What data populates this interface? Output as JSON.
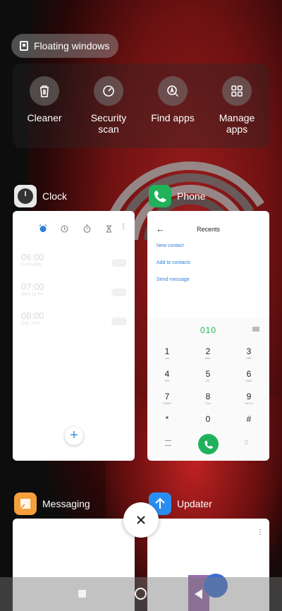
{
  "floating_windows": {
    "label": "Floating windows"
  },
  "tools": [
    {
      "label": "Cleaner",
      "icon": "trash-icon"
    },
    {
      "label": "Security scan",
      "icon": "shield-gauge-icon"
    },
    {
      "label": "Find apps",
      "icon": "search-a-icon"
    },
    {
      "label": "Manage apps",
      "icon": "grid-icon"
    }
  ],
  "apps": {
    "clock": {
      "name": "Clock",
      "alarms": [
        {
          "time": "06:00",
          "sub": "Everyday"
        },
        {
          "time": "07:00",
          "sub": "Mon to Fri"
        },
        {
          "time": "08:00",
          "sub": "Sat, Sun"
        }
      ],
      "fab": "+"
    },
    "phone": {
      "name": "Phone",
      "title": "Recents",
      "links": [
        "New contact",
        "Add to contacts",
        "Send message"
      ],
      "number": "010",
      "keys": [
        {
          "d": "1",
          "l": "ooo"
        },
        {
          "d": "2",
          "l": "ABC"
        },
        {
          "d": "3",
          "l": "DEF"
        },
        {
          "d": "4",
          "l": "GHI"
        },
        {
          "d": "5",
          "l": "JKL"
        },
        {
          "d": "6",
          "l": "MNO"
        },
        {
          "d": "7",
          "l": "PQRS"
        },
        {
          "d": "8",
          "l": "TUV"
        },
        {
          "d": "9",
          "l": "WXYZ"
        },
        {
          "d": "*",
          "l": ","
        },
        {
          "d": "0",
          "l": "+"
        },
        {
          "d": "#",
          "l": ""
        }
      ]
    },
    "messaging": {
      "name": "Messaging"
    },
    "updater": {
      "name": "Updater"
    }
  },
  "colors": {
    "accent_blue": "#2f80d8",
    "call_green": "#1fb25a",
    "clock_icon_bg": "#e8e8e8",
    "phone_icon_bg": "#1fb25a",
    "messaging_icon_bg": "#f5a03c",
    "updater_icon_bg": "#2a8ef0"
  }
}
